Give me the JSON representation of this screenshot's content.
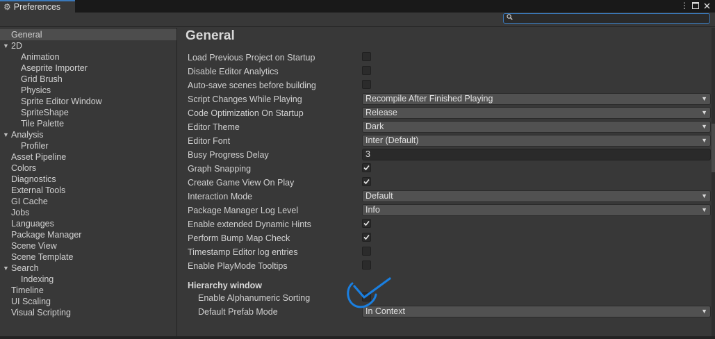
{
  "window": {
    "tab_title": "Preferences",
    "menu_icon": "kebab-menu-icon",
    "maximize_icon": "maximize-icon",
    "close_icon": "close-icon"
  },
  "search": {
    "value": "",
    "placeholder": ""
  },
  "sidebar": {
    "items": [
      {
        "label": "General",
        "level": 0,
        "selected": true
      },
      {
        "label": "2D",
        "level": 0,
        "expanded": true
      },
      {
        "label": "Animation",
        "level": 1
      },
      {
        "label": "Aseprite Importer",
        "level": 1
      },
      {
        "label": "Grid Brush",
        "level": 1
      },
      {
        "label": "Physics",
        "level": 1
      },
      {
        "label": "Sprite Editor Window",
        "level": 1
      },
      {
        "label": "SpriteShape",
        "level": 1
      },
      {
        "label": "Tile Palette",
        "level": 1
      },
      {
        "label": "Analysis",
        "level": 0,
        "expanded": true
      },
      {
        "label": "Profiler",
        "level": 1
      },
      {
        "label": "Asset Pipeline",
        "level": 0
      },
      {
        "label": "Colors",
        "level": 0
      },
      {
        "label": "Diagnostics",
        "level": 0
      },
      {
        "label": "External Tools",
        "level": 0
      },
      {
        "label": "GI Cache",
        "level": 0
      },
      {
        "label": "Jobs",
        "level": 0
      },
      {
        "label": "Languages",
        "level": 0
      },
      {
        "label": "Package Manager",
        "level": 0
      },
      {
        "label": "Scene View",
        "level": 0
      },
      {
        "label": "Scene Template",
        "level": 0
      },
      {
        "label": "Search",
        "level": 0,
        "expanded": true
      },
      {
        "label": "Indexing",
        "level": 1
      },
      {
        "label": "Timeline",
        "level": 0
      },
      {
        "label": "UI Scaling",
        "level": 0
      },
      {
        "label": "Visual Scripting",
        "level": 0
      }
    ]
  },
  "main": {
    "title": "General",
    "settings": [
      {
        "label": "Load Previous Project on Startup",
        "type": "checkbox",
        "checked": false
      },
      {
        "label": "Disable Editor Analytics",
        "type": "checkbox",
        "checked": false
      },
      {
        "label": "Auto-save scenes before building",
        "type": "checkbox",
        "checked": false
      },
      {
        "label": "Script Changes While Playing",
        "type": "dropdown",
        "value": "Recompile After Finished Playing"
      },
      {
        "label": "Code Optimization On Startup",
        "type": "dropdown",
        "value": "Release"
      },
      {
        "label": "Editor Theme",
        "type": "dropdown",
        "value": "Dark"
      },
      {
        "label": "Editor Font",
        "type": "dropdown",
        "value": "Inter (Default)"
      },
      {
        "label": "Busy Progress Delay",
        "type": "number",
        "value": "3"
      },
      {
        "label": "Graph Snapping",
        "type": "checkbox",
        "checked": true
      },
      {
        "label": "Create Game View On Play",
        "type": "checkbox",
        "checked": true
      },
      {
        "label": "Interaction Mode",
        "type": "dropdown",
        "value": "Default"
      },
      {
        "label": "Package Manager Log Level",
        "type": "dropdown",
        "value": "Info"
      },
      {
        "label": "Enable extended Dynamic Hints",
        "type": "checkbox",
        "checked": true
      },
      {
        "label": "Perform Bump Map Check",
        "type": "checkbox",
        "checked": true
      },
      {
        "label": "Timestamp Editor log entries",
        "type": "checkbox",
        "checked": false
      },
      {
        "label": "Enable PlayMode Tooltips",
        "type": "checkbox",
        "checked": false
      }
    ],
    "hierarchy": {
      "header": "Hierarchy window",
      "settings": [
        {
          "label": "Enable Alphanumeric Sorting",
          "type": "checkbox",
          "checked": false
        },
        {
          "label": "Default Prefab Mode",
          "type": "dropdown",
          "value": "In Context"
        }
      ]
    }
  },
  "icons": {
    "tab": "gear-icon",
    "search": "search-icon",
    "dropdown": "dropdown-arrow-icon",
    "tree_expanded": "triangle-down-icon",
    "check": "checkmark-icon"
  },
  "colors": {
    "accent": "#3a79bb",
    "panel": "#383838",
    "selected": "#4d4d4d",
    "annotation": "#1a7fe0"
  }
}
